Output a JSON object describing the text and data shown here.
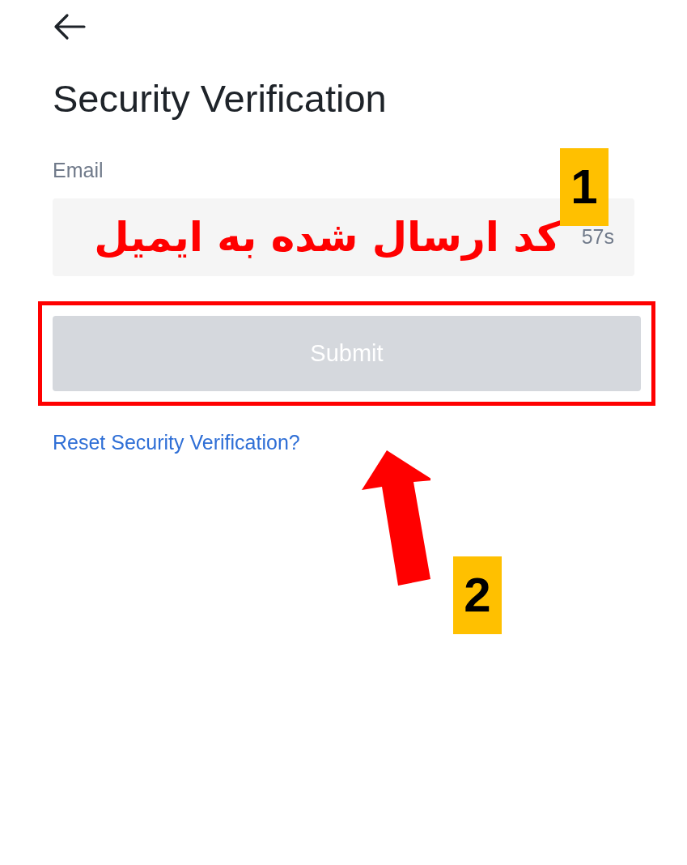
{
  "title": "Security Verification",
  "email": {
    "label": "Email",
    "countdown": "57s"
  },
  "submit": {
    "label": "Submit",
    "disabled": true
  },
  "reset_link": "Reset Security Verification?",
  "annotations": [
    {
      "kind": "note",
      "text": "کد ارسال شده به ایمیل"
    },
    {
      "kind": "badge",
      "text": "1"
    },
    {
      "kind": "badge",
      "text": "2"
    }
  ]
}
